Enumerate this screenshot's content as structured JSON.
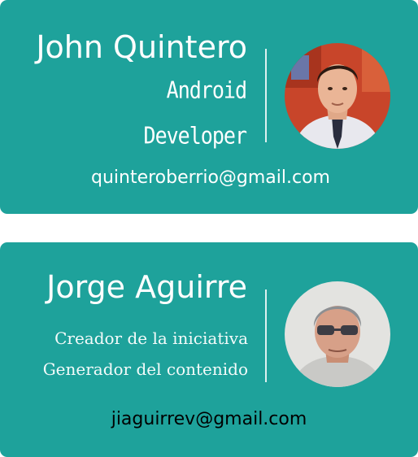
{
  "cards": [
    {
      "name": "John Quintero",
      "role_lines": [
        "Android",
        "Developer"
      ],
      "email": "quinteroberrio@gmail.com"
    },
    {
      "name": "Jorge Aguirre",
      "role_lines": [
        "Creador de la iniciativa",
        "Generador del contenido"
      ],
      "email": "jiaguirrev@gmail.com"
    }
  ],
  "colors": {
    "card_background": "#1ea29b",
    "text": "#ffffff"
  }
}
